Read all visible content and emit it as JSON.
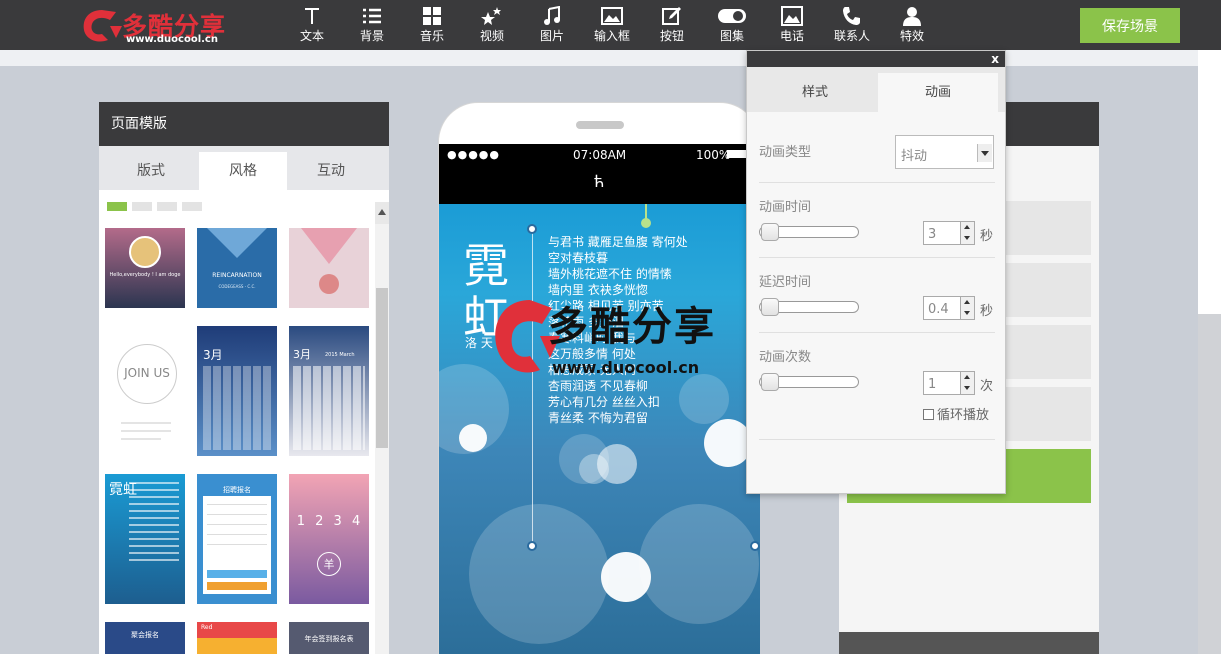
{
  "logo": {
    "name": "多酷分享",
    "url": "www.duocool.cn"
  },
  "toolbar": {
    "items": [
      {
        "label": "文本",
        "icon": "text-icon"
      },
      {
        "label": "背景",
        "icon": "list-icon"
      },
      {
        "label": "音乐",
        "icon": "grid-icon"
      },
      {
        "label": "视频",
        "icon": "stars-icon"
      },
      {
        "label": "图片",
        "icon": "music-note-icon"
      },
      {
        "label": "输入框",
        "icon": "image-icon"
      },
      {
        "label": "按钮",
        "icon": "edit-icon"
      },
      {
        "label": "图集",
        "icon": "toggle-icon"
      },
      {
        "label": "电话",
        "icon": "picture-icon"
      },
      {
        "label": "联系人",
        "icon": "phone-icon"
      },
      {
        "label": "特效",
        "icon": "user-icon"
      }
    ],
    "save_label": "保存场景"
  },
  "template_panel": {
    "title": "页面模版",
    "tabs": [
      "版式",
      "风格",
      "互动"
    ],
    "active_tab": "风格",
    "thumb_texts": {
      "doge": "Hello,everybody ! I am doge",
      "reincarnation": "REINCARNATION",
      "reincarnation_sub": "CODEGEASS - C.C.",
      "join_us": "JOIN US",
      "march": "3月",
      "march_en": "2015 March",
      "register": "招聘报名",
      "numbers": "1 2 3 4",
      "sheep": "羊",
      "party": "聚会报名",
      "red": "Red",
      "year_end": "年会签到报名表"
    }
  },
  "phone": {
    "signal": "●●●●●",
    "time": "07:08AM",
    "battery": "100%",
    "header_glyph": "ћ",
    "title": "霓虹",
    "author": "洛 天 依",
    "poem": [
      "与君书 藏雁足鱼腹 寄何处",
      "空对春枝暮",
      "墙外桃花遮不住 的情愫",
      "墙内里 衣袂多恍惚",
      "红尘路 相见苦 别亦苦",
      "落花雨 多少泪",
      "春寒料峭时 我与",
      "这万般多情 何处",
      "相思成冢 无人问",
      "杏雨润透 不见春柳",
      "芳心有几分 丝丝入扣",
      "青丝柔 不悔为君留"
    ]
  },
  "watermark": {
    "name": "多酷分享",
    "url": "www.duocool.cn"
  },
  "anim_popup": {
    "close": "x",
    "tabs": [
      "样式",
      "动画"
    ],
    "active_tab": "动画",
    "type_label": "动画类型",
    "type_value": "抖动",
    "duration_label": "动画时间",
    "duration_value": "3",
    "duration_unit": "秒",
    "delay_label": "延迟时间",
    "delay_value": "0.4",
    "delay_unit": "秒",
    "count_label": "动画次数",
    "count_value": "1",
    "count_unit": "次",
    "loop_label": "循环播放"
  },
  "colors": {
    "topbar": "#3a3a3c",
    "accent_green": "#8bc34a",
    "logo_red": "#e0303a"
  }
}
